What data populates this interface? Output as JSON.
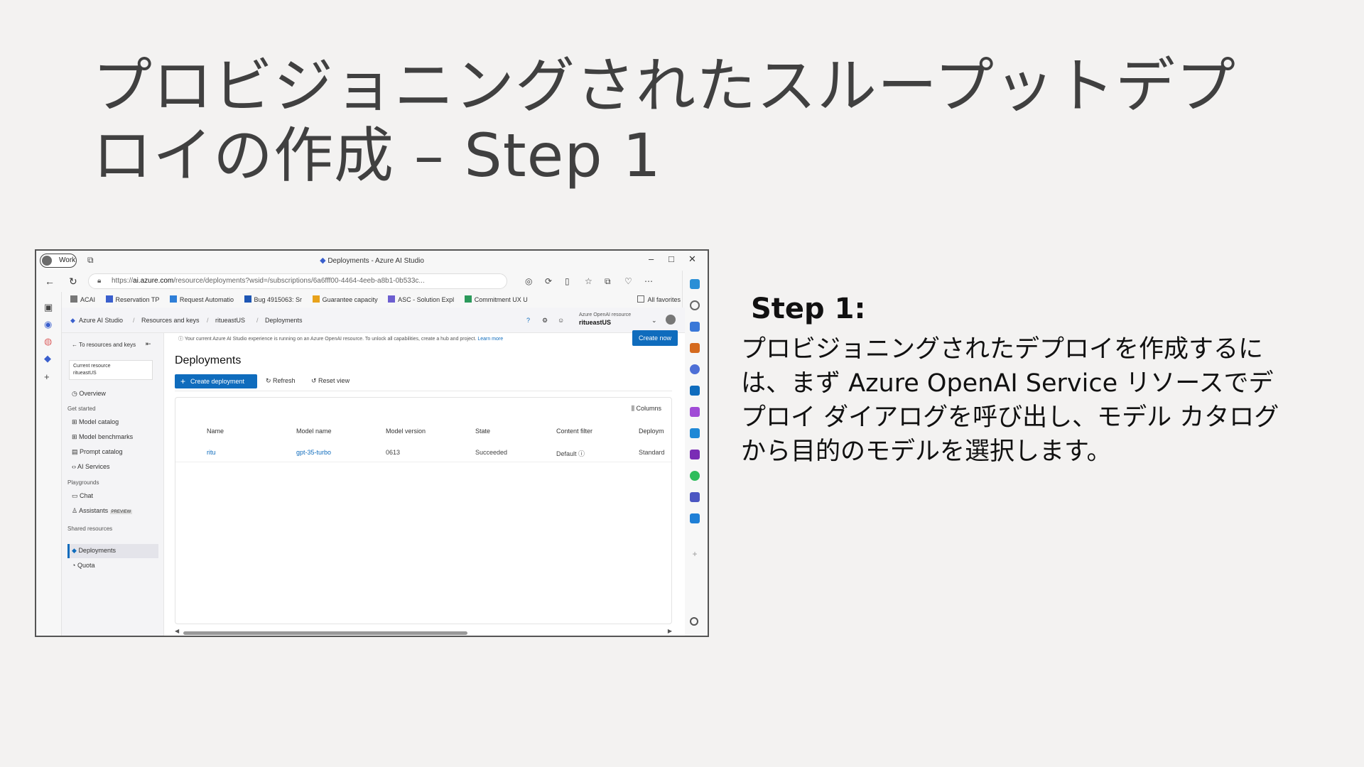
{
  "slide": {
    "title_line1": "プロビジョニングされたスループットデプ",
    "title_line2": "ロイの作成 – Step 1",
    "step_heading": "Step 1:",
    "step_body": "プロビジョニングされたデプロイを作成するには、まず Azure OpenAI Service リソースでデプロイ ダイアログを呼び出し、モデル カタログから目的のモデルを選択します。"
  },
  "browser": {
    "profile": "Work",
    "window_title": "Deployments - Azure AI Studio",
    "url_prefix": "https://",
    "url_domain": "ai.azure.com",
    "url_rest": "/resource/deployments?wsid=/subscriptions/6a6fff00-4464-4eeb-a8b1-0b533c...",
    "favorites": [
      "ACAI",
      "Reservation TP",
      "Request Automatio",
      "Bug 4915063: Sr",
      "Guarantee capacity",
      "ASC - Solution Expl",
      "Commitment UX U"
    ],
    "favorites_folder": "All favorites"
  },
  "studio": {
    "brand": "Azure AI Studio",
    "breadcrumb": [
      "Resources and keys",
      "ritueastUS",
      "Deployments"
    ],
    "resource_label": "Azure OpenAI resource",
    "resource_name": "ritueastUS",
    "back_link": "To resources and keys",
    "current_resource_label": "Current resource",
    "current_resource_name": "ritueastUS",
    "nav": {
      "overview": "Overview",
      "get_started": "Get started",
      "model_catalog": "Model catalog",
      "model_benchmarks": "Model benchmarks",
      "prompt_catalog": "Prompt catalog",
      "ai_services": "AI Services",
      "playgrounds": "Playgrounds",
      "chat": "Chat",
      "assistants": "Assistants",
      "preview": "PREVIEW",
      "shared_resources": "Shared resources",
      "deployments": "Deployments",
      "quota": "Quota"
    },
    "banner": "Your current Azure AI Studio experience is running on an Azure OpenAI resource. To unlock all capabilities, create a hub and project.",
    "banner_link": "Learn more",
    "create_now": "Create now",
    "page_title": "Deployments",
    "actions": {
      "create": "Create deployment",
      "refresh": "Refresh",
      "reset": "Reset view"
    },
    "columns_button": "Columns",
    "table": {
      "headers": [
        "Name",
        "Model name",
        "Model version",
        "State",
        "Content filter",
        "Deploym"
      ],
      "row": [
        "ritu",
        "gpt-35-turbo",
        "0613",
        "Succeeded",
        "Default",
        "Standard"
      ]
    }
  }
}
